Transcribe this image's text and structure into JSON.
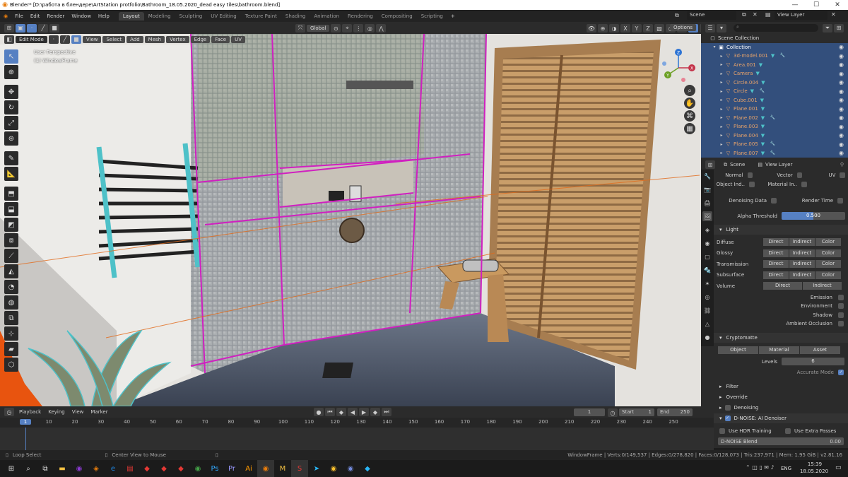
{
  "window": {
    "title": "Blender* [D:\\работа в блендере\\ArtStation protfolio\\Bathroom_18.05.2020_dead easy tiles\\bathroom.blend]"
  },
  "menu": [
    "File",
    "Edit",
    "Render",
    "Window",
    "Help"
  ],
  "workspaces": [
    "Layout",
    "Modeling",
    "Sculpting",
    "UV Editing",
    "Texture Paint",
    "Shading",
    "Animation",
    "Rendering",
    "Compositing",
    "Scripting"
  ],
  "active_workspace": "Layout",
  "scene_field": "Scene",
  "viewlayer_field": "View Layer",
  "viewport": {
    "mode": "Edit Mode",
    "menus": [
      "View",
      "Select",
      "Add",
      "Mesh",
      "Vertex",
      "Edge",
      "Face",
      "UV"
    ],
    "transform": "Global",
    "options": "Options",
    "overlay_line1": "User Perspective",
    "overlay_line2": "(1) WindowFrame",
    "gizmo_labels": {
      "x": "X",
      "y": "Y",
      "z": "Z"
    },
    "xyz_buttons": [
      "X",
      "Y",
      "Z"
    ]
  },
  "outliner": {
    "root": "Scene Collection",
    "collection": "Collection",
    "objects": [
      "3d-model.001",
      "Area.001",
      "Camera",
      "Circle.004",
      "Circle",
      "Cube.001",
      "Plane.001",
      "Plane.002",
      "Plane.003",
      "Plane.004",
      "Plane.005",
      "Plane.007"
    ]
  },
  "properties": {
    "header_scene": "Scene",
    "header_viewlayer": "View Layer",
    "row1": [
      "Normal",
      "Vector",
      "UV"
    ],
    "row2": [
      "Object Ind..",
      "Material In.."
    ],
    "denoising_data": "Denoising Data",
    "render_time": "Render Time",
    "alpha_threshold_label": "Alpha Threshold",
    "alpha_threshold_value": "0.500",
    "alpha_threshold_fraction": 0.5,
    "light_panel": "Light",
    "light_rows": [
      {
        "label": "Diffuse",
        "buttons": [
          "Direct",
          "Indirect",
          "Color"
        ]
      },
      {
        "label": "Glossy",
        "buttons": [
          "Direct",
          "Indirect",
          "Color"
        ]
      },
      {
        "label": "Transmission",
        "buttons": [
          "Direct",
          "Indirect",
          "Color"
        ]
      },
      {
        "label": "Subsurface",
        "buttons": [
          "Direct",
          "Indirect",
          "Color"
        ]
      },
      {
        "label": "Volume",
        "buttons": [
          "Direct",
          "Indirect"
        ]
      }
    ],
    "checks": [
      "Emission",
      "Environment",
      "Shadow",
      "Ambient Occlusion"
    ],
    "crypto_panel": "Cryptomatte",
    "crypto_buttons": [
      "Object",
      "Material",
      "Asset"
    ],
    "levels_label": "Levels",
    "levels_value": "6",
    "accurate_mode": "Accurate Mode",
    "filter_panel": "Filter",
    "override_panel": "Override",
    "denoising_panel": "Denoising",
    "dnoise_panel": "D-NOISE: AI Denoiser",
    "use_hdr": "Use HDR Training",
    "use_extra": "Use Extra Passes",
    "dnoise_blend_label": "D-NOISE Blend",
    "dnoise_blend_value": "0.00"
  },
  "timeline": {
    "menus": [
      "Playback",
      "Keying",
      "View",
      "Marker"
    ],
    "current_frame": "1",
    "start_label": "Start",
    "start_value": "1",
    "end_label": "End",
    "end_value": "250",
    "ticks": [
      "1",
      "10",
      "20",
      "30",
      "40",
      "50",
      "60",
      "70",
      "80",
      "90",
      "100",
      "110",
      "120",
      "130",
      "140",
      "150",
      "160",
      "170",
      "180",
      "190",
      "200",
      "210",
      "220",
      "230",
      "240",
      "250"
    ]
  },
  "status": {
    "left1": "Loop Select",
    "left2": "Center View to Mouse",
    "stats": "WindowFrame | Verts:0/149,537 | Edges:0/278,820 | Faces:0/128,073 | Tris:237,971 | Mem: 1.95 GiB | v2.81.16"
  },
  "taskbar": {
    "lang": "ENG",
    "time": "15:39",
    "date": "18.05.2020"
  },
  "colors": {
    "accent": "#5680c2",
    "selected_object": "#e8a36a",
    "edit_wire": "#d020c0",
    "mesh_outline": "#4ec1c8",
    "wood": "#c89a63"
  }
}
